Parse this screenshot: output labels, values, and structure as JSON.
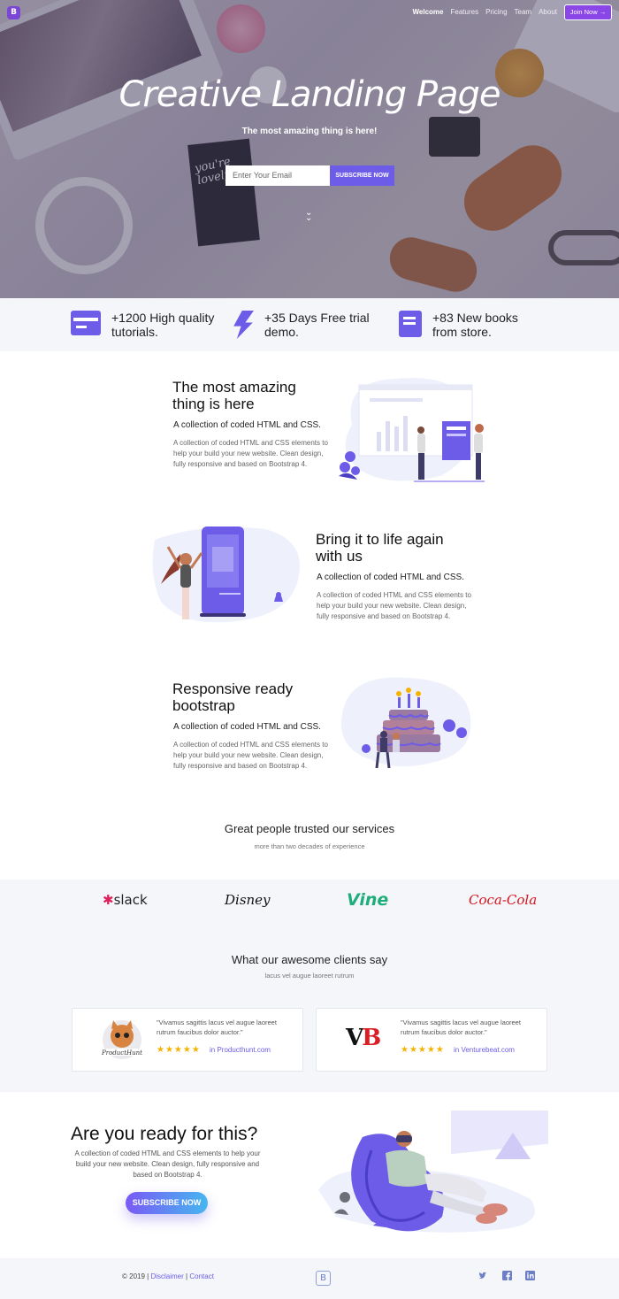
{
  "nav": {
    "brand": "B",
    "items": [
      "Welcome",
      "Features",
      "Pricing",
      "Team",
      "About"
    ],
    "join_label": "Join Now →"
  },
  "hero": {
    "title": "Creative Landing Page",
    "subtitle": "The most amazing thing is here!",
    "email_placeholder": "Enter Your Email",
    "subscribe_label": "SUBSCRIBE NOW",
    "notebook_text": "you're lovely."
  },
  "features": [
    {
      "icon": "credit-card-icon",
      "text": "+1200 High quality tutorials."
    },
    {
      "icon": "lightning-icon",
      "text": "+35 Days Free trial demo."
    },
    {
      "icon": "book-icon",
      "text": "+83 New books from store."
    }
  ],
  "blocks": [
    {
      "title": "The most amazing thing is here",
      "subtitle": "A collection of coded HTML and CSS.",
      "body": "A collection of coded HTML and CSS elements to help your build your new website. Clean design, fully responsive and based on Bootstrap 4."
    },
    {
      "title": "Bring it to life again with us",
      "subtitle": "A collection of coded HTML and CSS.",
      "body": "A collection of coded HTML and CSS elements to help your build your new website. Clean design, fully responsive and based on Bootstrap 4."
    },
    {
      "title": "Responsive ready bootstrap",
      "subtitle": "A collection of coded HTML and CSS.",
      "body": "A collection of coded HTML and CSS elements to help your build your new website. Clean design, fully responsive and based on Bootstrap 4."
    }
  ],
  "trusted": {
    "title": "Great people trusted our services",
    "subtitle": "more than two decades of experience",
    "logos": [
      "slack",
      "Disney",
      "Vine",
      "Coca-Cola"
    ]
  },
  "testimonials": {
    "title": "What our awesome clients say",
    "subtitle": "lacus vel augue laoreet rutrum",
    "items": [
      {
        "quote": "\"Vivamus sagittis lacus vel augue laoreet rutrum faucibus dolor auctor.\"",
        "stars": "★★★★★",
        "source": "in Producthunt.com",
        "logo": "kitty"
      },
      {
        "quote": "\"Vivamus sagittis lacus vel augue laoreet rutrum faucibus dolor auctor.\"",
        "stars": "★★★★★",
        "source": "in Venturebeat.com",
        "logo": "VB"
      }
    ]
  },
  "cta": {
    "title": "Are you ready for this?",
    "body": "A collection of coded HTML and CSS elements to help your build your new website. Clean design, fully responsive and based on Bootstrap 4.",
    "button": "SUBSCRIBE NOW"
  },
  "footer": {
    "copyright": "© 2019 |",
    "disclaimer": "Disclaimer",
    "separator": "|",
    "contact": "Contact",
    "brand": "B",
    "social": [
      "twitter-icon",
      "facebook-icon",
      "linkedin-icon"
    ]
  },
  "colors": {
    "accent": "#6c5ce7",
    "join": "#8a46e6",
    "strip": "#f4f6fa",
    "star": "#f5b301"
  }
}
